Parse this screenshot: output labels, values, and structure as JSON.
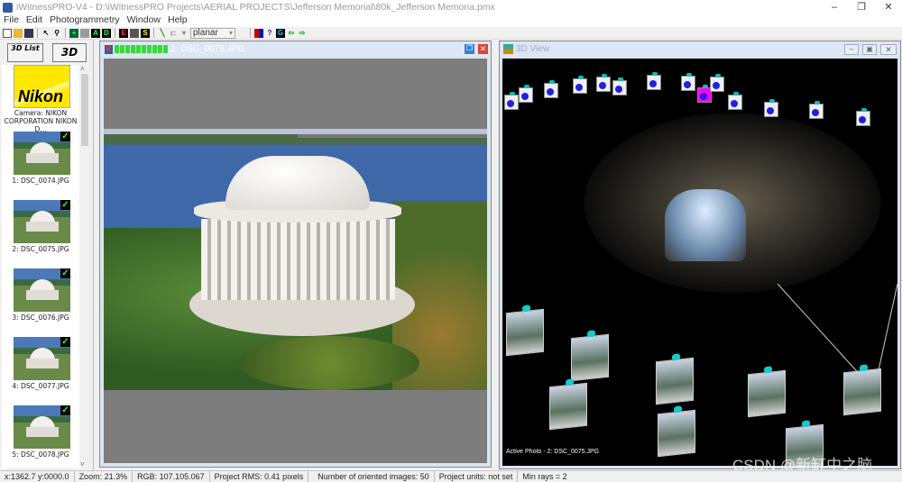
{
  "title": "iWitnessPRO-V4 - D:\\iWitnessPRO Projects\\AERIAL PROJECTS\\Jefferson Memorial\\80k_Jefferson Memoria.pmx",
  "menu": [
    "File",
    "Edit",
    "Photogrammetry",
    "Window",
    "Help"
  ],
  "toolbar": {
    "mode_select": "planar",
    "buttons": [
      "A",
      "D",
      "E",
      "S",
      "G"
    ]
  },
  "left": {
    "list_button": "3D List",
    "view_button": "3D",
    "camera_brand": "Nikon",
    "camera_label": "Camera: NIKON CORPORATION NIKON D...",
    "photos": [
      {
        "label": "1: DSC_0074.JPG"
      },
      {
        "label": "2: DSC_0075.JPG"
      },
      {
        "label": "3: DSC_0076.JPG"
      },
      {
        "label": "4: DSC_0077.JPG"
      },
      {
        "label": "5: DSC_0078.JPG"
      }
    ]
  },
  "photo_window": {
    "badge": "R",
    "title": "2: DSC_0075.JPG"
  },
  "view3d": {
    "title": "3D View",
    "active_photo": "Active Photo - 2: DSC_0075.JPG"
  },
  "status": {
    "coords": "x:1362.7  y:0000.0",
    "zoom": "Zoom: 21.3%",
    "rgb": "RGB: 107.105.067",
    "rms": "Project RMS: 0.41 pixels",
    "oriented": "Number of oriented images: 50",
    "units": "Project units: not set",
    "min_rays": "Min rays = 2"
  },
  "watermark": "CSDN @新缸中之脑",
  "colors": {
    "accent": "#2a5ea8",
    "check": "#33ff33",
    "active_camera": "#ff00ff"
  }
}
